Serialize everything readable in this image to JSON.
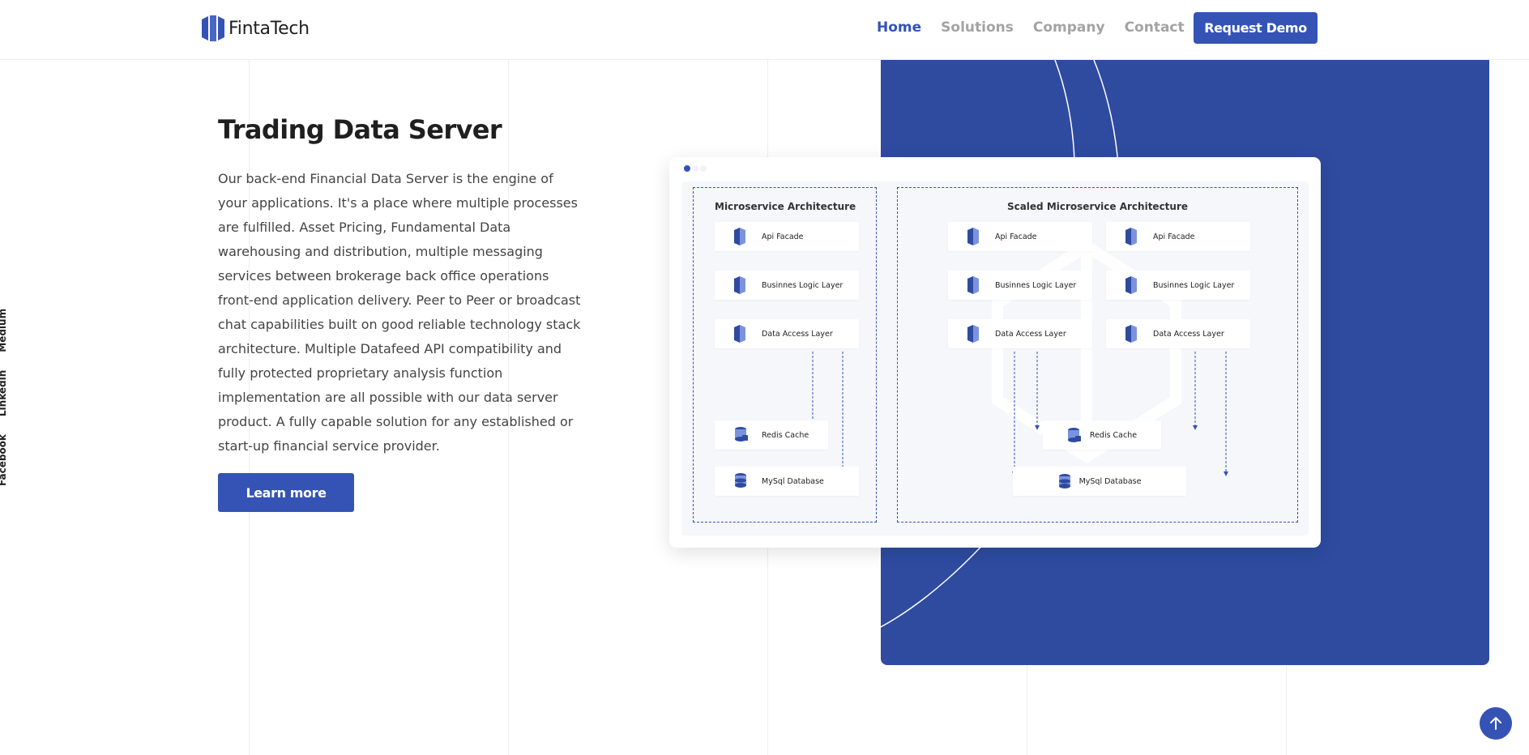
{
  "brand": {
    "name": "FintaTech",
    "logo_icon": "logo-icon",
    "accent": "#3453b5"
  },
  "nav": {
    "items": [
      {
        "label": "Home",
        "active": true
      },
      {
        "label": "Solutions",
        "active": false
      },
      {
        "label": "Company",
        "active": false
      },
      {
        "label": "Contact",
        "active": false
      }
    ],
    "cta": "Request Demo"
  },
  "social": [
    "Facebook",
    "Linkedin",
    "Medium"
  ],
  "hero": {
    "title": "Trading Data Server",
    "body": "Our back-end Financial Data Server is the engine of your applications. It's a place where multiple processes are fulfilled. Asset Pricing, Fundamental Data warehousing and distribution, multiple messaging services between brokerage back office operations front-end application delivery. Peer to Peer or broadcast chat capabilities built on good reliable technology stack architecture. Multiple Datafeed API compatibility and fully protected proprietary analysis function implementation are all possible with our data server product. A fully capable solution for any established or start-up financial service provider.",
    "cta": "Learn more"
  },
  "panel_color": "#2e4ba0",
  "diagram": {
    "micro": {
      "title": "Microservice Architecture",
      "api": "Api Facade",
      "logic": "Businnes Logic Layer",
      "data": "Data Access Layer",
      "cache": "Redis Cache",
      "db": "MySql Database"
    },
    "scaled": {
      "title": "Scaled Microservice Architecture",
      "left": {
        "api": "Api Facade",
        "logic": "Businnes Logic Layer",
        "data": "Data Access Layer"
      },
      "right": {
        "api": "Api Facade",
        "logic": "Businnes Logic Layer",
        "data": "Data Access Layer"
      },
      "cache": "Redis Cache",
      "db": "MySql Database"
    }
  },
  "scroll_top_icon": "arrow-up-icon"
}
